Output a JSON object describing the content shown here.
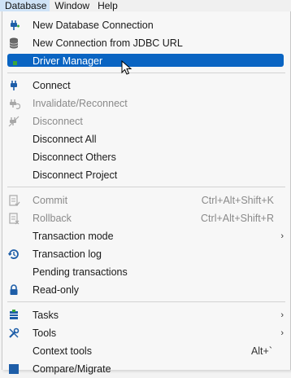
{
  "menubar": [
    {
      "label": "Database",
      "active": true
    },
    {
      "label": "Window",
      "active": false
    },
    {
      "label": "Help",
      "active": false
    }
  ],
  "menu": {
    "new_database_connection": "New Database Connection",
    "new_connection_jdbc": "New Connection from JDBC URL",
    "driver_manager": "Driver Manager",
    "connect": "Connect",
    "invalidate_reconnect": "Invalidate/Reconnect",
    "disconnect": "Disconnect",
    "disconnect_all": "Disconnect All",
    "disconnect_others": "Disconnect Others",
    "disconnect_project": "Disconnect Project",
    "commit": "Commit",
    "commit_shortcut": "Ctrl+Alt+Shift+K",
    "rollback": "Rollback",
    "rollback_shortcut": "Ctrl+Alt+Shift+R",
    "transaction_mode": "Transaction mode",
    "transaction_log": "Transaction log",
    "pending_transactions": "Pending transactions",
    "read_only": "Read-only",
    "tasks": "Tasks",
    "tools": "Tools",
    "context_tools": "Context tools",
    "context_tools_shortcut": "Alt+`",
    "compare_migrate": "Compare/Migrate"
  },
  "icons": {
    "accent": "#0a64c2",
    "plug": "#1e5ea8",
    "green": "#3aa53a",
    "disabled": "#a8a8a8"
  }
}
